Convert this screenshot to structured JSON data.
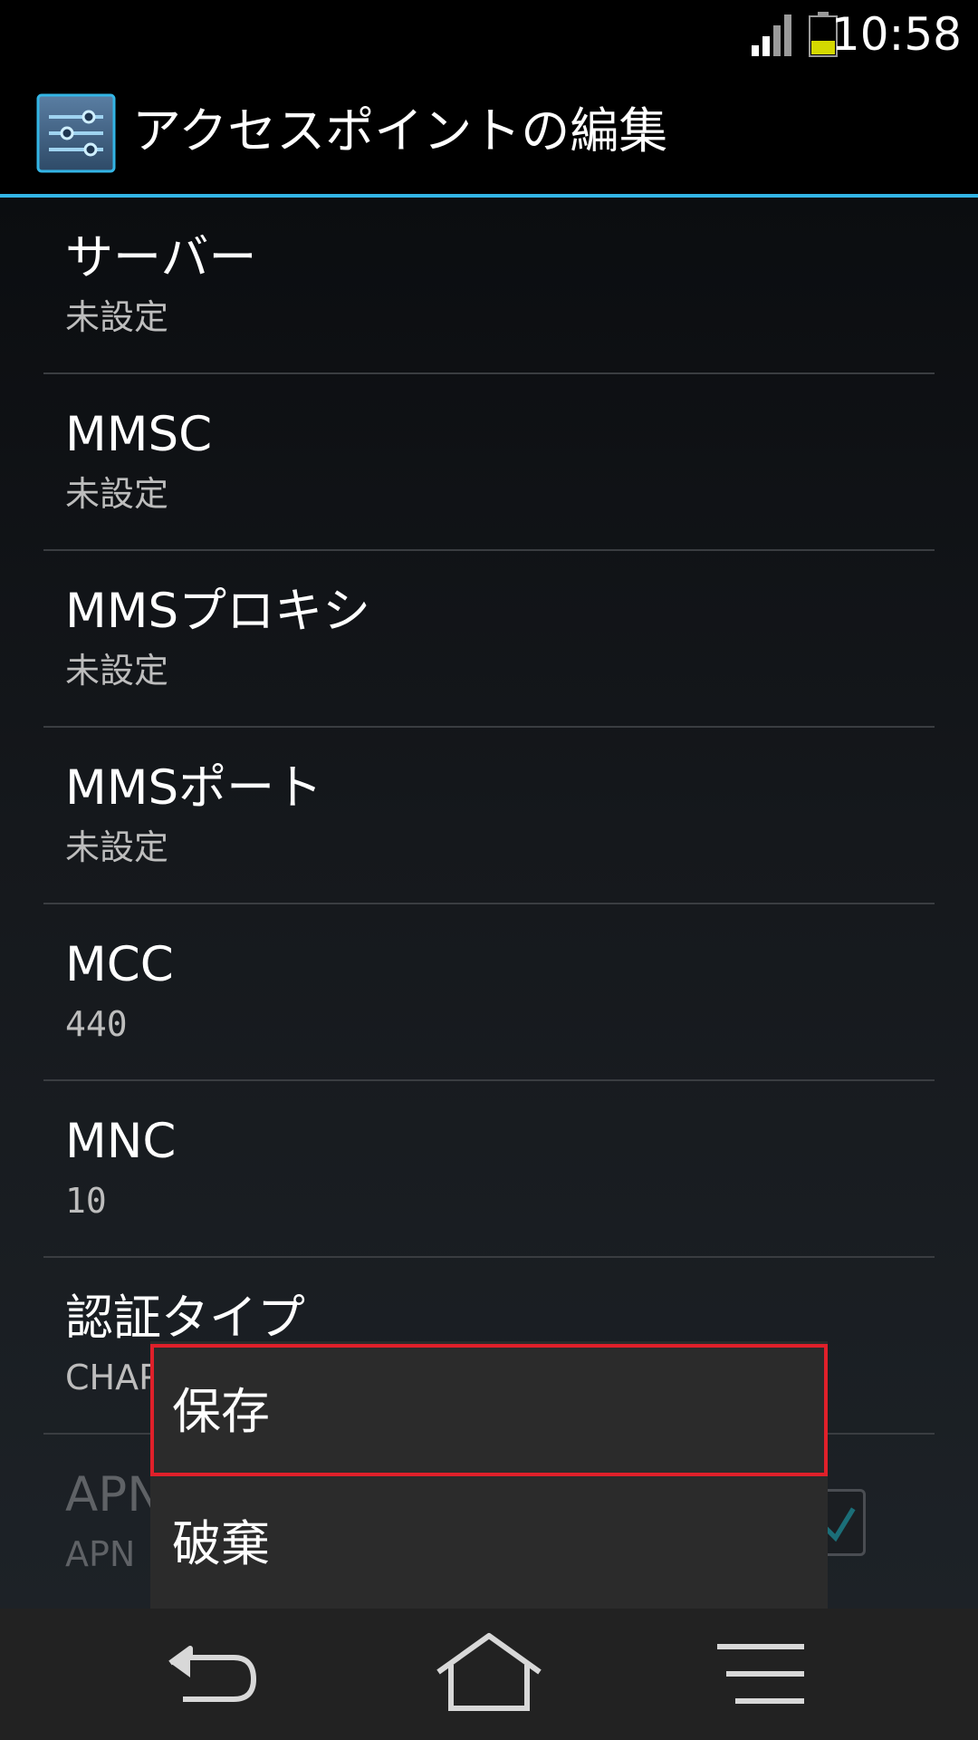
{
  "status_bar": {
    "time": "10:58",
    "icons": [
      "signal-icon",
      "battery-icon"
    ],
    "battery_color": "#d4d800"
  },
  "action_bar": {
    "title": "アクセスポイントの編集",
    "icon": "settings-sliders-icon",
    "accent_color": "#33b5e5"
  },
  "preferences": [
    {
      "title": "サーバー",
      "summary": "未設定"
    },
    {
      "title": "MMSC",
      "summary": "未設定"
    },
    {
      "title": "MMSプロキシ",
      "summary": "未設定"
    },
    {
      "title": "MMSポート",
      "summary": "未設定"
    },
    {
      "title": "MCC",
      "summary": "440"
    },
    {
      "title": "MNC",
      "summary": "10"
    },
    {
      "title": "認証タイプ",
      "summary": "CHAP"
    },
    {
      "title": "APN",
      "summary": "APN",
      "disabled": true
    }
  ],
  "menu": {
    "items": [
      {
        "label": "保存",
        "highlighted": true
      },
      {
        "label": "破棄",
        "highlighted": false
      }
    ],
    "highlight_color": "#e0202a"
  },
  "nav_bar": {
    "icons": [
      "back-icon",
      "home-icon",
      "menu-icon"
    ]
  }
}
